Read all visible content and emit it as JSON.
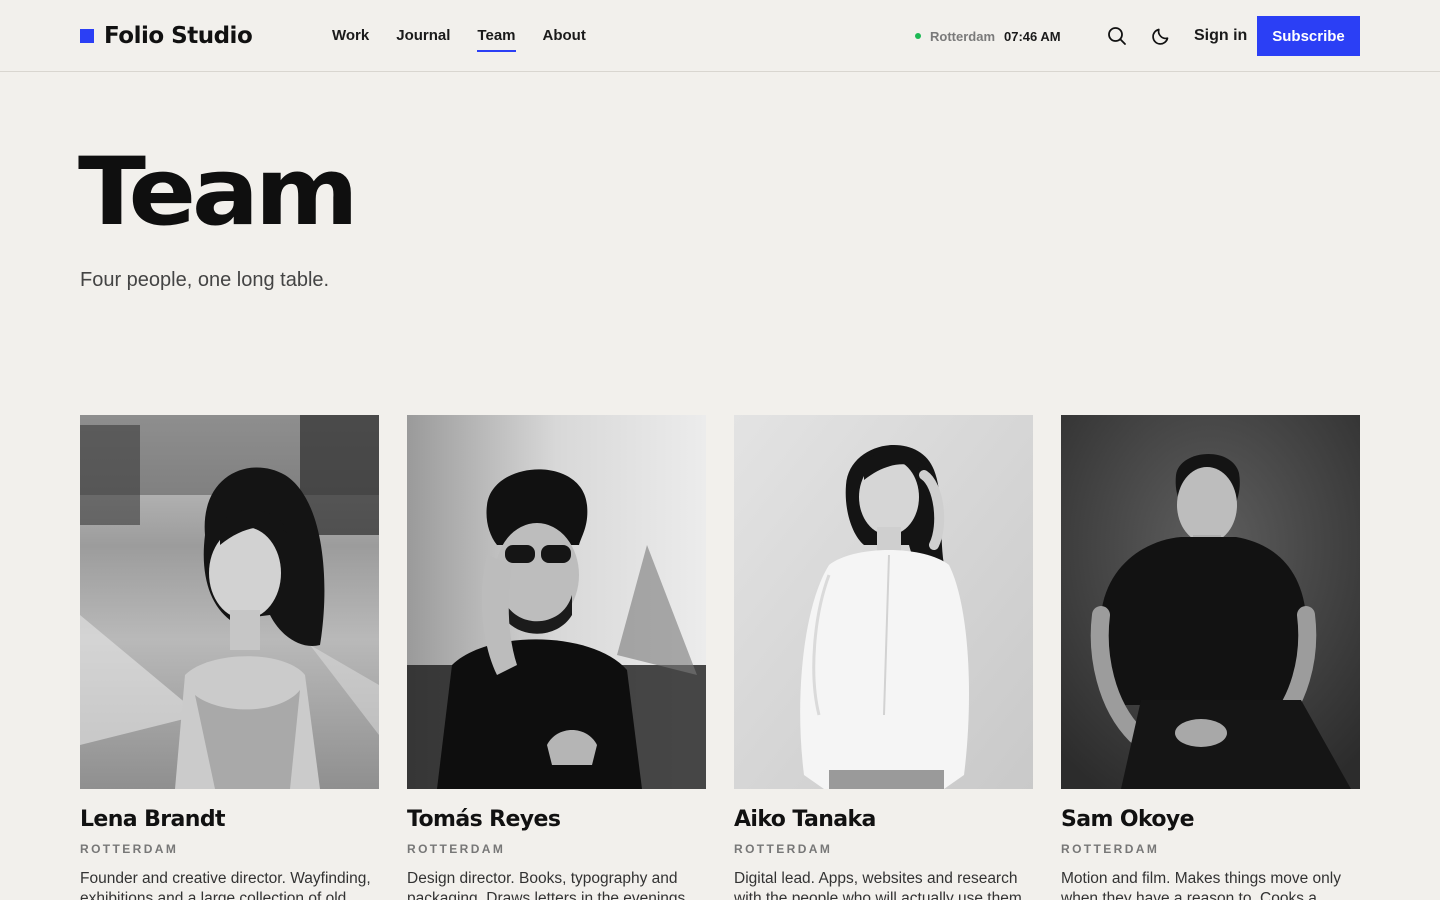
{
  "brand": {
    "name": "Folio Studio",
    "accent": "#2b3ff5"
  },
  "nav": {
    "items": [
      {
        "label": "Work",
        "active": false
      },
      {
        "label": "Journal",
        "active": false
      },
      {
        "label": "Team",
        "active": true
      },
      {
        "label": "About",
        "active": false
      }
    ]
  },
  "status": {
    "city": "Rotterdam",
    "time": "07:46 AM",
    "dot_color": "#1db954"
  },
  "header": {
    "search_icon": "search-icon",
    "theme_icon": "moon-icon",
    "signin_label": "Sign in",
    "subscribe_label": "Subscribe"
  },
  "hero": {
    "title": "Team",
    "subtitle": "Four people, one long table."
  },
  "team": [
    {
      "name": "Lena Brandt",
      "location": "ROTTERDAM",
      "bio": "Founder and creative director. Wayfinding, exhibitions and a large collection of old"
    },
    {
      "name": "Tomás Reyes",
      "location": "ROTTERDAM",
      "bio": "Design director. Books, typography and packaging. Draws letters in the evenings."
    },
    {
      "name": "Aiko Tanaka",
      "location": "ROTTERDAM",
      "bio": "Digital lead. Apps, websites and research with the people who will actually use them."
    },
    {
      "name": "Sam Okoye",
      "location": "ROTTERDAM",
      "bio": "Motion and film. Makes things move only when they have a reason to. Cooks a"
    }
  ]
}
